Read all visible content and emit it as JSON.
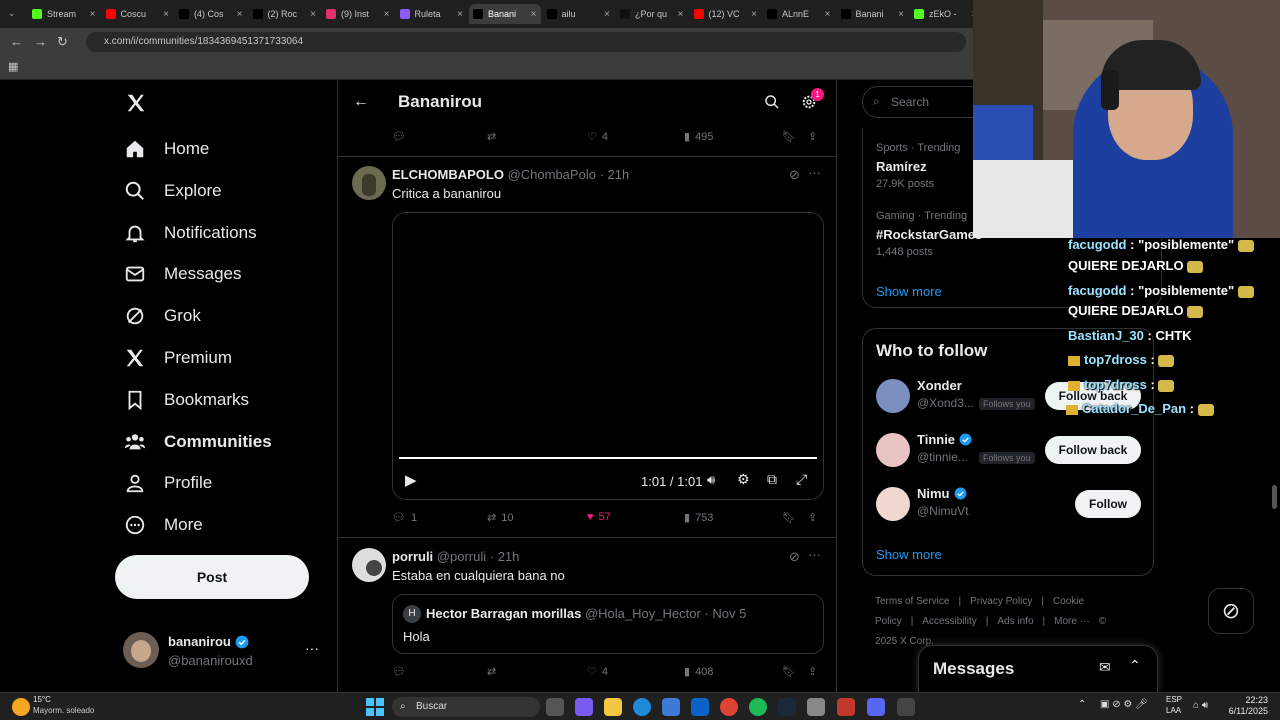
{
  "browser": {
    "tabs": [
      {
        "label": "Stream",
        "color": "#53fc18"
      },
      {
        "label": "Coscu",
        "color": "#ff0000"
      },
      {
        "label": "(4) Cos",
        "color": "#000000"
      },
      {
        "label": "(2) Roc",
        "color": "#000000"
      },
      {
        "label": "(9) Inst",
        "color": "#e1306c"
      },
      {
        "label": "Ruleta",
        "color": "#8a5cf6"
      },
      {
        "label": "Banani",
        "color": "#000000"
      },
      {
        "label": "ailu",
        "color": "#000000"
      },
      {
        "label": "¿Por qu",
        "color": "#111111"
      },
      {
        "label": "(12) VC",
        "color": "#ff0000"
      },
      {
        "label": "ALnnE",
        "color": "#000000"
      },
      {
        "label": "Banani",
        "color": "#000000"
      },
      {
        "label": "zEkO -",
        "color": "#53fc18"
      }
    ],
    "url": "x.com/i/communities/1834369451371733064"
  },
  "nav": {
    "items": [
      {
        "label": "Home",
        "icon": "home-icon"
      },
      {
        "label": "Explore",
        "icon": "search-icon"
      },
      {
        "label": "Notifications",
        "icon": "bell-icon"
      },
      {
        "label": "Messages",
        "icon": "mail-icon"
      },
      {
        "label": "Grok",
        "icon": "grok-icon"
      },
      {
        "label": "Premium",
        "icon": "x-icon"
      },
      {
        "label": "Bookmarks",
        "icon": "bookmark-icon"
      },
      {
        "label": "Communities",
        "icon": "communities-icon"
      },
      {
        "label": "Profile",
        "icon": "person-icon"
      },
      {
        "label": "More",
        "icon": "more-circle-icon"
      }
    ],
    "post_label": "Post",
    "account": {
      "name": "bananirou",
      "handle": "@bananirouxd"
    }
  },
  "header": {
    "title": "Bananirou",
    "notif_count": "1"
  },
  "top_actions": {
    "likes": "4",
    "views": "495"
  },
  "post1": {
    "name": "ELCHOMBAPOLO",
    "handle": "@ChombaPolo",
    "time": "· 21h",
    "text": "Critica a bananirou",
    "video_time": "1:01 / 1:01",
    "replies": "1",
    "reposts": "10",
    "likes": "57",
    "views": "753"
  },
  "post2": {
    "name": "porruli",
    "handle": "@porruli",
    "time": "· 21h",
    "text": "Estaba en cualquiera bana no",
    "quote": {
      "initial": "H",
      "name": "Hector Barragan morillas",
      "handle": "@Hola_Hoy_Hector",
      "time": "· Nov 5",
      "text": "Hola"
    },
    "likes": "4",
    "views": "408"
  },
  "sidebar": {
    "search_placeholder": "Search",
    "trends": [
      {
        "meta": "Sports · Trending",
        "name": "Ramírez",
        "count": "27.9K posts"
      },
      {
        "meta": "Gaming · Trending",
        "name": "#RockstarGames",
        "count": "1,448 posts"
      }
    ],
    "show_more": "Show more",
    "who_to_follow_title": "Who to follow",
    "follow": [
      {
        "name": "Xonder",
        "handle": "@Xond3...",
        "badge": "Follows you",
        "button": "Follow back"
      },
      {
        "name": "Tinnie",
        "handle": "@tinnie...",
        "badge": "Follows you",
        "button": "Follow back"
      },
      {
        "name": "Nimu",
        "handle": "@NimuVt",
        "badge": "",
        "button": "Follow"
      }
    ],
    "show_more_2": "Show more",
    "footer": [
      "Terms of Service",
      "|",
      "Privacy Policy",
      "|",
      "Cookie Policy",
      "|",
      "Accessibility",
      "|",
      "Ads info",
      "|",
      "More ···",
      "© 2025 X Corp."
    ],
    "messages_label": "Messages"
  },
  "chat": [
    {
      "name": "facugodd",
      "text": ": \"posiblemente\""
    },
    {
      "name": "",
      "text": "QUIERE DEJARLO"
    },
    {
      "name": "facugodd",
      "text": ": \"posiblemente\""
    },
    {
      "name": "",
      "text": "QUIERE DEJARLO"
    },
    {
      "name": "BastianJ_30",
      "text": ": CHTK"
    },
    {
      "name": "top7dross",
      "text": ":"
    },
    {
      "name": "top7dross",
      "text": ":"
    },
    {
      "name": "Catador_De_Pan",
      "text": ":"
    }
  ],
  "taskbar": {
    "weather_temp": "15°C",
    "weather_text": "Mayorm. soleado",
    "search_label": "Buscar",
    "lang": "ESP",
    "lang2": "LAA",
    "time": "22:23",
    "date": "6/11/2025"
  }
}
